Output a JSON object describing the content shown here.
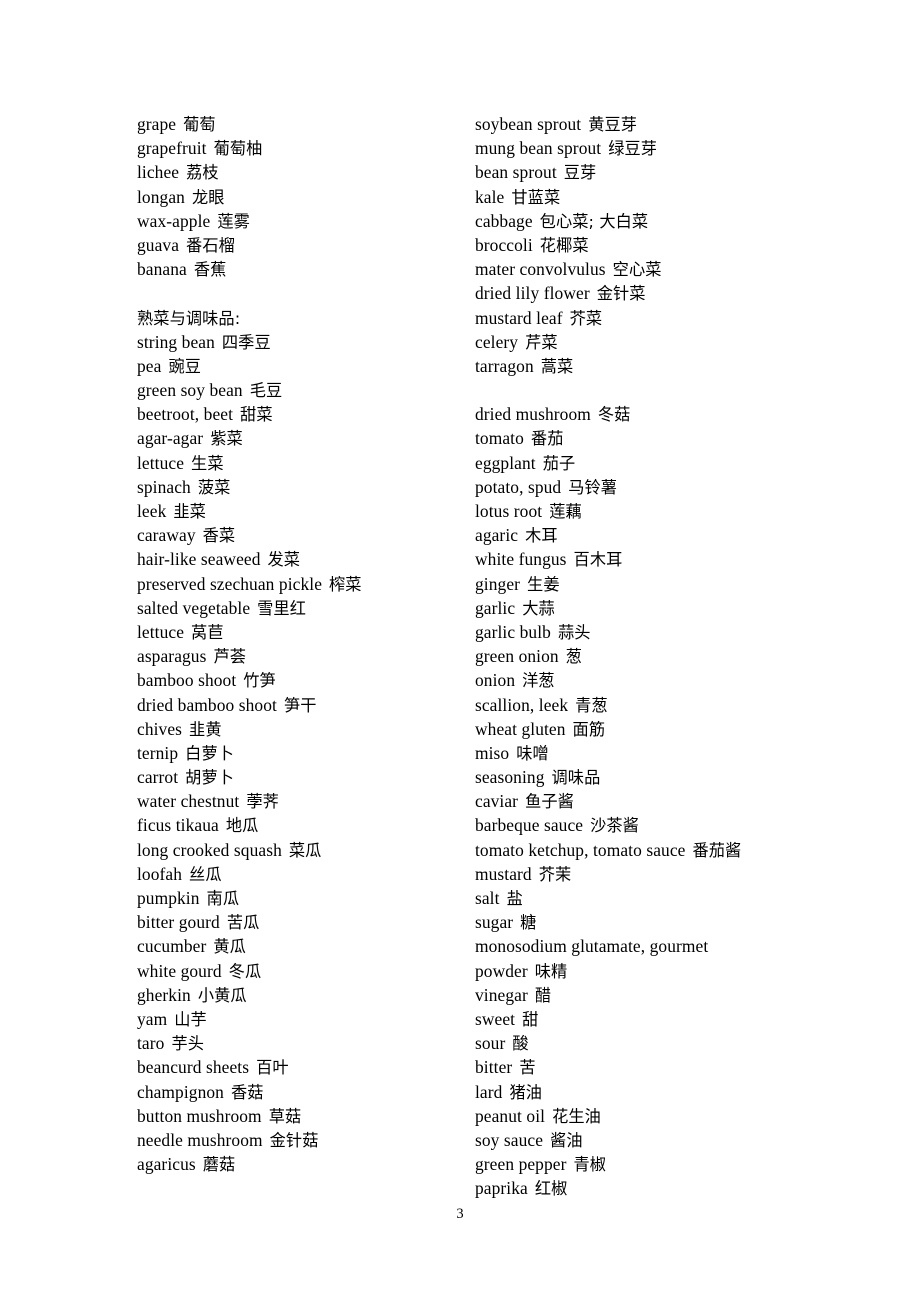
{
  "page": {
    "number": "3",
    "type": "bilingual-glossary"
  },
  "columns": {
    "left": {
      "entries": [
        {
          "en": "grape",
          "zh": "葡萄"
        },
        {
          "en": "grapefruit",
          "zh": "葡萄柚"
        },
        {
          "en": "lichee",
          "zh": "荔枝"
        },
        {
          "en": "longan",
          "zh": "龙眼"
        },
        {
          "en": "wax-apple",
          "zh": "莲雾"
        },
        {
          "en": "guava",
          "zh": "番石榴"
        },
        {
          "en": "banana",
          "zh": "香蕉"
        },
        {
          "spacer": true
        },
        {
          "heading": true,
          "en": "",
          "zh": "熟菜与调味品:"
        },
        {
          "en": "string bean",
          "zh": "四季豆"
        },
        {
          "en": "pea",
          "zh": "豌豆"
        },
        {
          "en": "green soy bean",
          "zh": "毛豆"
        },
        {
          "en": "beetroot, beet",
          "zh": "甜菜"
        },
        {
          "en": "agar-agar",
          "zh": "紫菜"
        },
        {
          "en": "lettuce",
          "zh": "生菜"
        },
        {
          "en": "spinach",
          "zh": "菠菜"
        },
        {
          "en": "leek",
          "zh": "韭菜"
        },
        {
          "en": "caraway",
          "zh": "香菜"
        },
        {
          "en": "hair-like seaweed",
          "zh": "发菜"
        },
        {
          "en": "preserved szechuan pickle",
          "zh": "榨菜"
        },
        {
          "en": "salted vegetable",
          "zh": "雪里红"
        },
        {
          "en": "lettuce",
          "zh": "莴苣"
        },
        {
          "en": "asparagus",
          "zh": "芦荟"
        },
        {
          "en": "bamboo shoot",
          "zh": "竹笋"
        },
        {
          "en": "dried bamboo shoot",
          "zh": "笋干"
        },
        {
          "en": "chives",
          "zh": "韭黄"
        },
        {
          "en": "ternip",
          "zh": "白萝卜"
        },
        {
          "en": "carrot",
          "zh": "胡萝卜"
        },
        {
          "en": "water chestnut",
          "zh": "荸荠"
        },
        {
          "en": "ficus tikaua",
          "zh": "地瓜"
        },
        {
          "en": "long crooked squash",
          "zh": "菜瓜"
        },
        {
          "en": "loofah",
          "zh": "丝瓜"
        },
        {
          "en": "pumpkin",
          "zh": "南瓜"
        },
        {
          "en": "bitter gourd",
          "zh": "苦瓜"
        },
        {
          "en": "cucumber",
          "zh": "黄瓜"
        },
        {
          "en": "white gourd",
          "zh": "冬瓜"
        },
        {
          "en": "gherkin",
          "zh": "小黄瓜"
        },
        {
          "en": "yam",
          "zh": "山芋"
        },
        {
          "en": "taro",
          "zh": "芋头"
        },
        {
          "en": "beancurd sheets",
          "zh": "百叶"
        },
        {
          "en": "champignon",
          "zh": "香菇"
        },
        {
          "en": "button mushroom",
          "zh": "草菇"
        },
        {
          "en": "needle mushroom",
          "zh": "金针菇"
        },
        {
          "en": "agaricus",
          "zh": "蘑菇"
        }
      ]
    },
    "right": {
      "entries": [
        {
          "en": "soybean sprout",
          "zh": "黄豆芽"
        },
        {
          "en": "mung bean sprout",
          "zh": "绿豆芽"
        },
        {
          "en": "bean sprout",
          "zh": "豆芽"
        },
        {
          "en": "kale",
          "zh": "甘蓝菜"
        },
        {
          "en": "cabbage",
          "zh": "包心菜; 大白菜"
        },
        {
          "en": "broccoli",
          "zh": "花椰菜"
        },
        {
          "en": "mater convolvulus",
          "zh": "空心菜"
        },
        {
          "en": "dried lily flower",
          "zh": "金针菜"
        },
        {
          "en": "mustard leaf",
          "zh": "芥菜"
        },
        {
          "en": "celery",
          "zh": "芹菜"
        },
        {
          "en": "tarragon",
          "zh": "蒿菜"
        },
        {
          "spacer": true
        },
        {
          "en": "dried mushroom",
          "zh": "冬菇"
        },
        {
          "en": "tomato",
          "zh": "番茄"
        },
        {
          "en": "eggplant",
          "zh": "茄子"
        },
        {
          "en": "potato, spud",
          "zh": "马铃薯"
        },
        {
          "en": "lotus root",
          "zh": "莲藕"
        },
        {
          "en": "agaric",
          "zh": "木耳"
        },
        {
          "en": "white fungus",
          "zh": "百木耳"
        },
        {
          "en": "ginger",
          "zh": "生姜"
        },
        {
          "en": "garlic",
          "zh": "大蒜"
        },
        {
          "en": "garlic bulb",
          "zh": "蒜头"
        },
        {
          "en": "green onion",
          "zh": "葱"
        },
        {
          "en": "onion",
          "zh": "洋葱"
        },
        {
          "en": "scallion, leek",
          "zh": "青葱"
        },
        {
          "en": "wheat gluten",
          "zh": "面筋"
        },
        {
          "en": "miso",
          "zh": "味噌"
        },
        {
          "en": "seasoning",
          "zh": "调味品"
        },
        {
          "en": "caviar",
          "zh": "鱼子酱"
        },
        {
          "en": "barbeque sauce",
          "zh": "沙茶酱"
        },
        {
          "en": "tomato ketchup, tomato sauce",
          "zh": "番茄酱"
        },
        {
          "en": "mustard",
          "zh": "芥茉"
        },
        {
          "en": "salt",
          "zh": "盐"
        },
        {
          "en": "sugar",
          "zh": "糖"
        },
        {
          "en": "monosodium glutamate, gourmet",
          "zh": ""
        },
        {
          "en": "powder",
          "zh": "味精",
          "continuation": true
        },
        {
          "en": "vinegar",
          "zh": "醋"
        },
        {
          "en": "sweet",
          "zh": "甜"
        },
        {
          "en": "sour",
          "zh": "酸"
        },
        {
          "en": "bitter",
          "zh": "苦"
        },
        {
          "en": "lard",
          "zh": "猪油"
        },
        {
          "en": "peanut oil",
          "zh": "花生油"
        },
        {
          "en": "soy sauce",
          "zh": "酱油"
        },
        {
          "en": "green pepper",
          "zh": "青椒"
        },
        {
          "en": "paprika",
          "zh": "红椒"
        }
      ]
    }
  }
}
